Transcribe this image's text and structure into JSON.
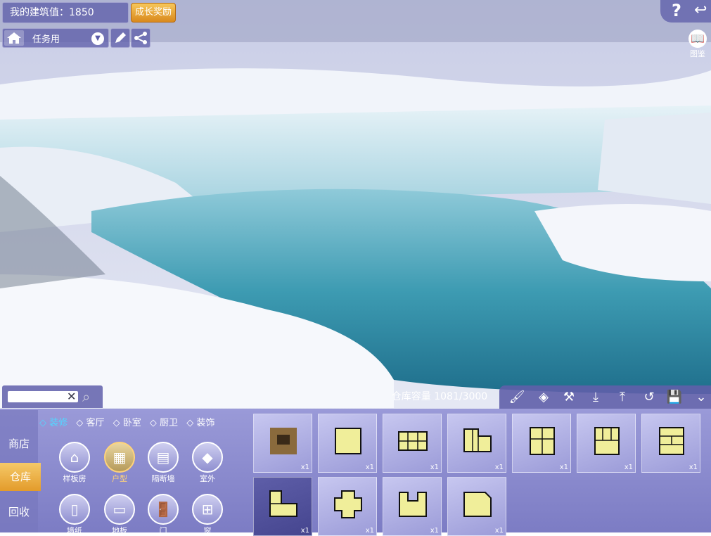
{
  "hud": {
    "build_value": "我的建筑值：1850",
    "growth_reward": "成长奖励",
    "task_label": "任务用",
    "help": "?",
    "back": "↩",
    "atlas_label": "图鉴"
  },
  "warehouse": {
    "capacity_label": "仓库容量",
    "capacity_value": "1081/3000"
  },
  "side_tabs": [
    "商店",
    "仓库",
    "回收"
  ],
  "sub_tabs": [
    "装修",
    "客厅",
    "卧室",
    "厨卫",
    "装饰"
  ],
  "categories": [
    "样板房",
    "户型",
    "隔断墙",
    "室外",
    "墙纸",
    "地板",
    "门",
    "窗"
  ],
  "items_qty": [
    "x1",
    "x1",
    "x1",
    "x1",
    "x1",
    "x1",
    "x1",
    "x1",
    "x1",
    "x1",
    "x1"
  ],
  "colors": {
    "accent": "#53d6ff",
    "panel": "#8c8cd0",
    "gold": "#e3a23a",
    "floor": "#f0ee9a"
  }
}
